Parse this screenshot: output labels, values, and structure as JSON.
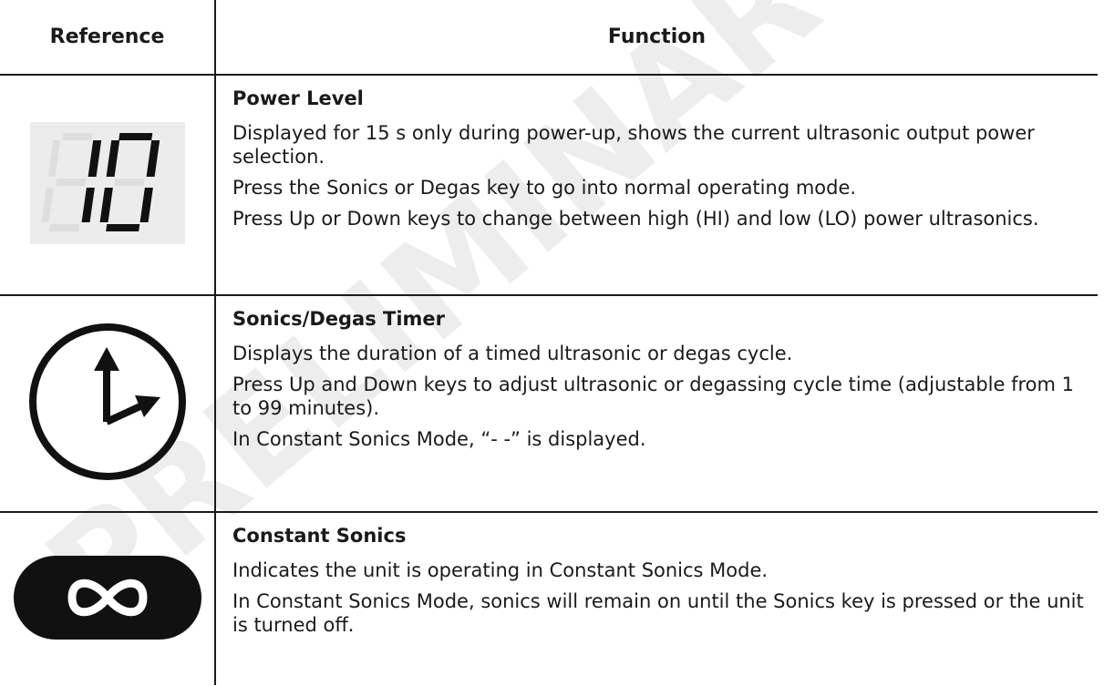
{
  "table": {
    "headers": {
      "reference": "Reference",
      "function": "Function"
    },
    "rows": [
      {
        "icon": "seven-segment-display-icon",
        "display_digits": "10",
        "title": "Power Level",
        "lines": [
          "Displayed for 15 s only during power-up, shows the current ultrasonic output power selection.",
          "Press the Sonics or Degas key to go into normal operating mode.",
          "Press Up or Down keys to change between high (HI) and low (LO) power ultrasonics."
        ]
      },
      {
        "icon": "clock-icon",
        "title": "Sonics/Degas Timer",
        "lines": [
          "Displays the duration of a timed ultrasonic or degas cycle.",
          "Press Up and Down keys to adjust ultrasonic or degassing cycle time (adjustable from 1 to 99 minutes).",
          "In Constant Sonics Mode, “- -” is displayed."
        ]
      },
      {
        "icon": "infinity-icon",
        "title": "Constant Sonics",
        "lines": [
          "Indicates the unit is operating in Constant Sonics Mode.",
          "In Constant Sonics Mode, sonics will remain on until the Sonics key is pressed or the unit is turned off."
        ]
      }
    ]
  },
  "watermark": {
    "text": "PRELIMINARY",
    "color": "#000000"
  }
}
